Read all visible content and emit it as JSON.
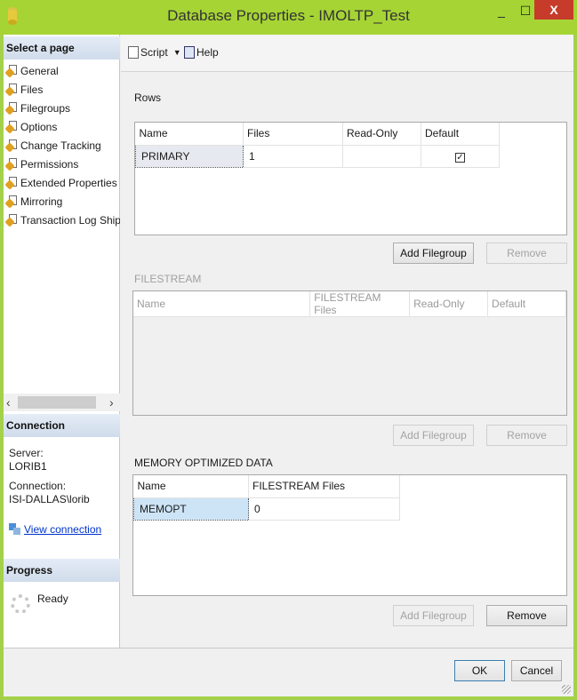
{
  "window": {
    "title": "Database Properties - IMOLTP_Test",
    "minimize": "_",
    "maximize": "☐",
    "close": "X"
  },
  "sidebar": {
    "select_page_header": "Select a page",
    "pages": [
      {
        "label": "General"
      },
      {
        "label": "Files"
      },
      {
        "label": "Filegroups"
      },
      {
        "label": "Options"
      },
      {
        "label": "Change Tracking"
      },
      {
        "label": "Permissions"
      },
      {
        "label": "Extended Properties"
      },
      {
        "label": "Mirroring"
      },
      {
        "label": "Transaction Log Shipping"
      }
    ],
    "connection_header": "Connection",
    "server_label": "Server:",
    "server_value": "LORIB1",
    "connection_label": "Connection:",
    "connection_value": "ISI-DALLAS\\lorib",
    "view_connection": "View connection",
    "progress_header": "Progress",
    "progress_status": "Ready"
  },
  "toolbar": {
    "script_label": "Script",
    "help_label": "Help"
  },
  "rows_section": {
    "label": "Rows",
    "columns": [
      "Name",
      "Files",
      "Read-Only",
      "Default"
    ],
    "rows": [
      {
        "name": "PRIMARY",
        "files": "1",
        "read_only": "",
        "default_checked": "✓"
      }
    ],
    "add_button": "Add Filegroup",
    "remove_button": "Remove"
  },
  "filestream_section": {
    "label": "FILESTREAM",
    "columns": [
      "Name",
      "FILESTREAM Files",
      "Read-Only",
      "Default"
    ],
    "add_button": "Add Filegroup",
    "remove_button": "Remove"
  },
  "memory_section": {
    "label": "MEMORY OPTIMIZED DATA",
    "columns": [
      "Name",
      "FILESTREAM Files"
    ],
    "rows": [
      {
        "name": "MEMOPT",
        "files": "0"
      }
    ],
    "add_button": "Add Filegroup",
    "remove_button": "Remove"
  },
  "footer": {
    "ok_button": "OK",
    "cancel_button": "Cancel"
  }
}
